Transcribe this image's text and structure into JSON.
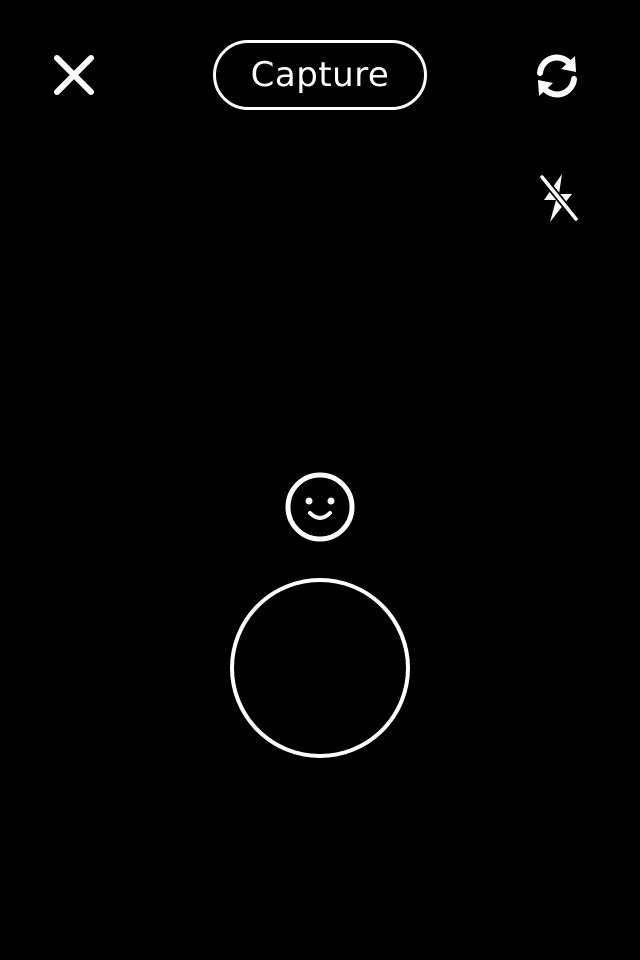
{
  "colors": {
    "background": "#000000",
    "foreground": "#ffffff"
  },
  "top_bar": {
    "close_icon": "close-icon",
    "title_button_label": "Capture",
    "flip_camera_icon": "refresh-icon"
  },
  "controls": {
    "flash_icon": "flash-off-icon",
    "face_filter_icon": "smiley-face-icon",
    "shutter_icon": "shutter-circle"
  }
}
